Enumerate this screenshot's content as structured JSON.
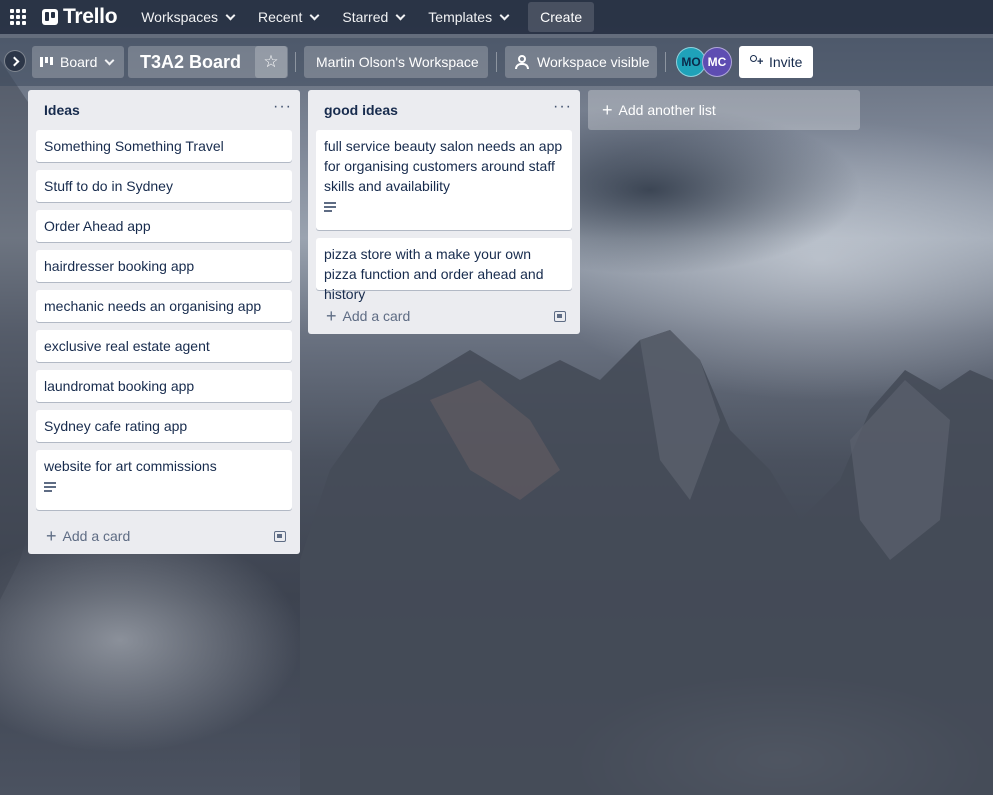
{
  "topnav": {
    "logo": "Trello",
    "items": [
      {
        "label": "Workspaces"
      },
      {
        "label": "Recent"
      },
      {
        "label": "Starred"
      },
      {
        "label": "Templates"
      }
    ],
    "create_label": "Create"
  },
  "board_header": {
    "view_label": "Board",
    "title": "T3A2 Board",
    "workspace": "Martin Olson's Workspace",
    "visibility": "Workspace visible",
    "members": [
      {
        "initials": "MO",
        "color": "#1fa2b9"
      },
      {
        "initials": "MC",
        "color": "#5e4db2"
      }
    ],
    "invite_label": "Invite"
  },
  "lists": [
    {
      "title": "Ideas",
      "cards": [
        {
          "text": "Something Something Travel"
        },
        {
          "text": "Stuff to do in Sydney"
        },
        {
          "text": "Order Ahead app"
        },
        {
          "text": "hairdresser booking app"
        },
        {
          "text": "mechanic needs an organising app"
        },
        {
          "text": "exclusive real estate agent"
        },
        {
          "text": "laundromat booking app"
        },
        {
          "text": "Sydney cafe rating app"
        },
        {
          "text": "website for art commissions",
          "has_description": true
        }
      ],
      "add_card_label": "Add a card"
    },
    {
      "title": "good ideas",
      "cards": [
        {
          "text": "full service beauty salon needs an app for organising customers around staff skills and availability",
          "has_description": true
        },
        {
          "text": "pizza store with a make your own pizza function and order ahead and history"
        }
      ],
      "add_card_label": "Add a card"
    }
  ],
  "add_list_label": "Add another list"
}
